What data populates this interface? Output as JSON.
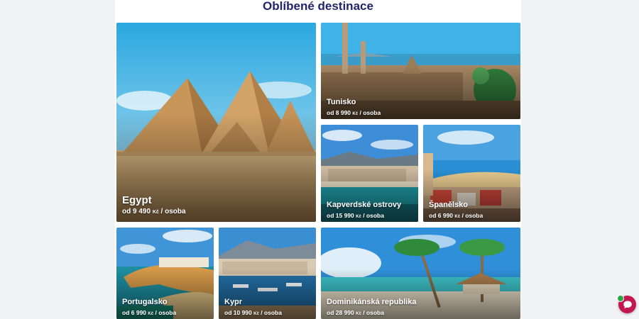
{
  "section": {
    "title": "Oblíbené destinace"
  },
  "destinations": [
    {
      "name": "Egypt",
      "price_prefix": "od",
      "price": "9 490",
      "currency": "Kč",
      "per": "/ osoba"
    },
    {
      "name": "Tunisko",
      "price_prefix": "od",
      "price": "8 990",
      "currency": "Kč",
      "per": "/ osoba"
    },
    {
      "name": "Kapverdské ostrovy",
      "price_prefix": "od",
      "price": "15 990",
      "currency": "Kč",
      "per": "/ osoba"
    },
    {
      "name": "Španělsko",
      "price_prefix": "od",
      "price": "6 990",
      "currency": "Kč",
      "per": "/ osoba"
    },
    {
      "name": "Portugalsko",
      "price_prefix": "od",
      "price": "6 990",
      "currency": "Kč",
      "per": "/ osoba"
    },
    {
      "name": "Kypr",
      "price_prefix": "od",
      "price": "10 990",
      "currency": "Kč",
      "per": "/ osoba"
    },
    {
      "name": "Dominikánská republika",
      "price_prefix": "od",
      "price": "28 990",
      "currency": "Kč",
      "per": "/ osoba"
    }
  ],
  "chat": {
    "icon": "chat-bubble-icon",
    "status_color": "#28a745",
    "accent": "#c5174f"
  }
}
